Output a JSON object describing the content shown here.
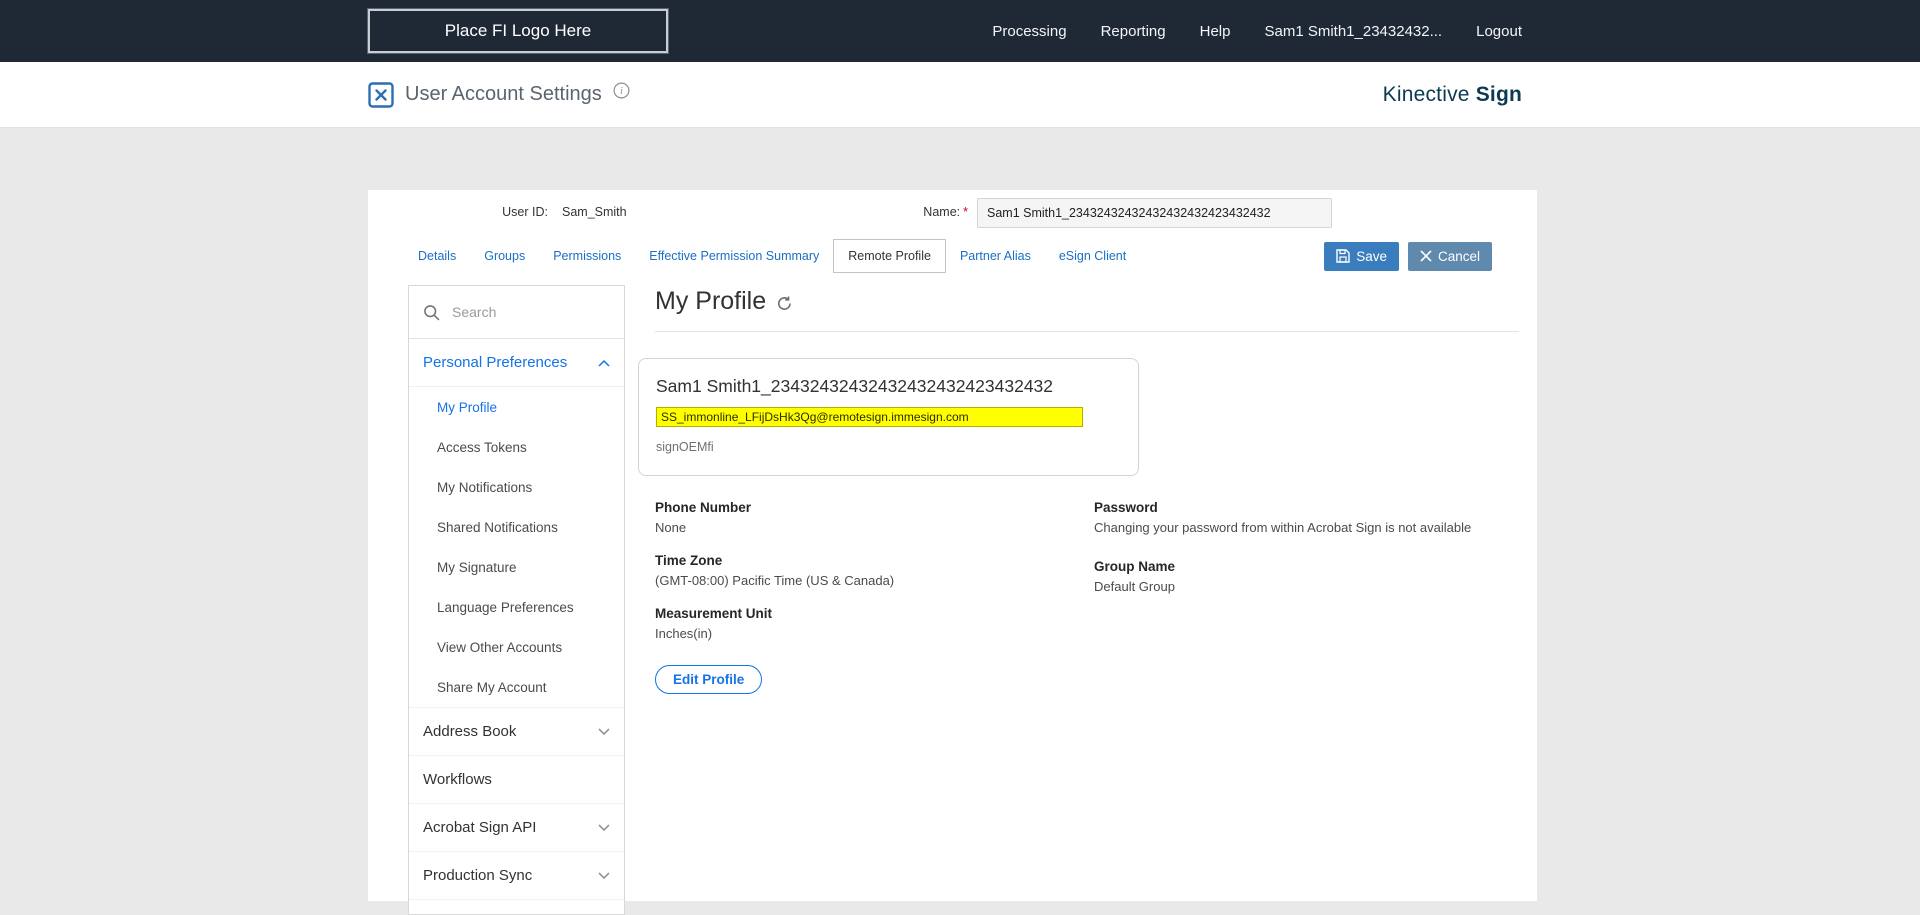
{
  "colors": {
    "topbar_bg": "#1f2936",
    "accent_blue": "#1473e6",
    "tab_link_blue": "#1a6fc4",
    "save_button_bg": "#3a7dbe",
    "cancel_button_bg": "#6089ae",
    "highlight_yellow": "#ffff00",
    "brand_teal": "#0d3a52",
    "required_red": "#d0021b"
  },
  "topbar": {
    "logo_placeholder": "Place FI Logo Here",
    "nav": [
      {
        "label": "Processing"
      },
      {
        "label": "Reporting"
      },
      {
        "label": "Help"
      },
      {
        "label": "Sam1 Smith1_23432432..."
      },
      {
        "label": "Logout"
      }
    ]
  },
  "header": {
    "title": "User Account Settings",
    "brand_name": "Kinective",
    "brand_product": "Sign"
  },
  "account": {
    "user_id_label": "User ID:",
    "user_id_value": "Sam_Smith",
    "name_label": "Name:",
    "required_mark": "*",
    "name_value": "Sam1 Smith1_23432432432432432432423432432"
  },
  "tabs": [
    {
      "label": "Details",
      "active": false
    },
    {
      "label": "Groups",
      "active": false
    },
    {
      "label": "Permissions",
      "active": false
    },
    {
      "label": "Effective Permission Summary",
      "active": false
    },
    {
      "label": "Remote Profile",
      "active": true
    },
    {
      "label": "Partner Alias",
      "active": false
    },
    {
      "label": "eSign Client",
      "active": false
    }
  ],
  "actions": {
    "save_label": "Save",
    "cancel_label": "Cancel"
  },
  "sidebar": {
    "search_placeholder": "Search",
    "groups": [
      {
        "label": "Personal Preferences",
        "expanded": true,
        "active_item": "My Profile",
        "items": [
          "My Profile",
          "Access Tokens",
          "My Notifications",
          "Shared Notifications",
          "My Signature",
          "Language Preferences",
          "View Other Accounts",
          "Share My Account"
        ]
      },
      {
        "label": "Address Book",
        "expanded": false
      },
      {
        "label": "Workflows"
      },
      {
        "label": "Acrobat Sign API",
        "expanded": false
      },
      {
        "label": "Production Sync",
        "expanded": false
      }
    ]
  },
  "profile": {
    "heading": "My Profile",
    "card": {
      "display_name": "Sam1 Smith1_23432432432432432432423432432",
      "email": "SS_immonline_LFijDsHk3Qg@remotesign.immesign.com",
      "company": "signOEMfi"
    },
    "phone": {
      "label": "Phone Number",
      "value": "None"
    },
    "timezone": {
      "label": "Time Zone",
      "value": "(GMT-08:00) Pacific Time (US & Canada)"
    },
    "measurement": {
      "label": "Measurement Unit",
      "value": "Inches(in)"
    },
    "password": {
      "label": "Password",
      "value": "Changing your password from within Acrobat Sign is not available"
    },
    "group": {
      "label": "Group Name",
      "value": "Default Group"
    },
    "edit_button_label": "Edit Profile"
  }
}
